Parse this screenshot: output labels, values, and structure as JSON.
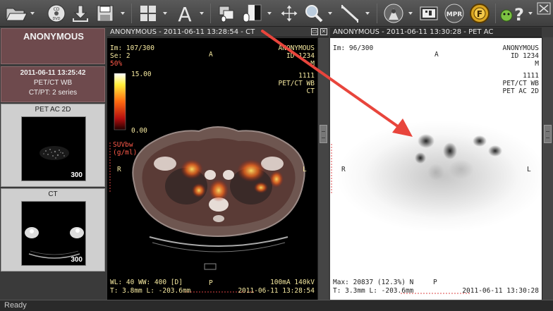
{
  "toolbar": {
    "icons": [
      "open-folder-icon",
      "cd-dvd-icon",
      "download-icon",
      "save-icon",
      "layout-grid-icon",
      "text-annotation-icon",
      "series-sync-icon",
      "window-level-icon",
      "pan-icon",
      "zoom-icon",
      "measure-line-icon",
      "3d-render-icon",
      "cine-film-icon",
      "mpr-icon",
      "fusion-icon",
      "help-icon",
      "fullscreen-icon"
    ],
    "cd_label": "CD\nDVD",
    "text_glyph": "A",
    "mpr_label": "MPR",
    "fusion_label": "F",
    "help_glyph": "?"
  },
  "left_panel": {
    "patient_name": "ANONYMOUS",
    "study": {
      "date": "2011-06-11 13:25:42",
      "description": "PET/CT WB",
      "series_info": "CT/PT: 2 series"
    },
    "series": [
      {
        "title": "PET AC 2D",
        "count": "300"
      },
      {
        "title": "CT",
        "count": "300"
      }
    ]
  },
  "viewport1": {
    "title": "ANONYMOUS - 2011-06-11 13:28:54 - CT",
    "im": "Im: 107/300",
    "se": "Se: 2",
    "opacity": "50%",
    "scale_max": "15.00",
    "scale_min": "0.00",
    "unit_line1": "SUVbw",
    "unit_line2": "(g/ml)",
    "patient_name": "ANONYMOUS",
    "patient_id": "ID 1234",
    "sex": "M",
    "study_id": "1111",
    "study_desc": "PET/CT WB",
    "modality": "CT",
    "orient_top": "A",
    "orient_left": "R",
    "orient_right": "L",
    "orient_bottom": "P",
    "wl": "WL: 40 WW: 400 [D]",
    "thickness": "T: 3.8mm L: -203.6mm",
    "exposure": "100mA 140kV",
    "datetime": "2011-06-11 13:28:54"
  },
  "viewport2": {
    "title": "ANONYMOUS - 2011-06-11 13:30:28 - PET AC",
    "im": "Im: 96/300",
    "patient_name": "ANONYMOUS",
    "patient_id": "ID 1234",
    "sex": "M",
    "study_id": "1111",
    "study_desc": "PET/CT WB",
    "series_desc": "PET AC 2D",
    "orient_top": "A",
    "orient_left": "R",
    "orient_right": "L",
    "orient_bottom": "P",
    "max": "Max: 20837 (12.3%) N",
    "thickness": "T: 3.3mm L: -203.6mm",
    "datetime": "2011-06-11 13:30:28"
  },
  "status": {
    "text": "Ready"
  },
  "colors": {
    "annotation_arrow": "#e8453c",
    "patient_box": "#6e4a4d",
    "overlay_text": "#f6e9a0"
  }
}
